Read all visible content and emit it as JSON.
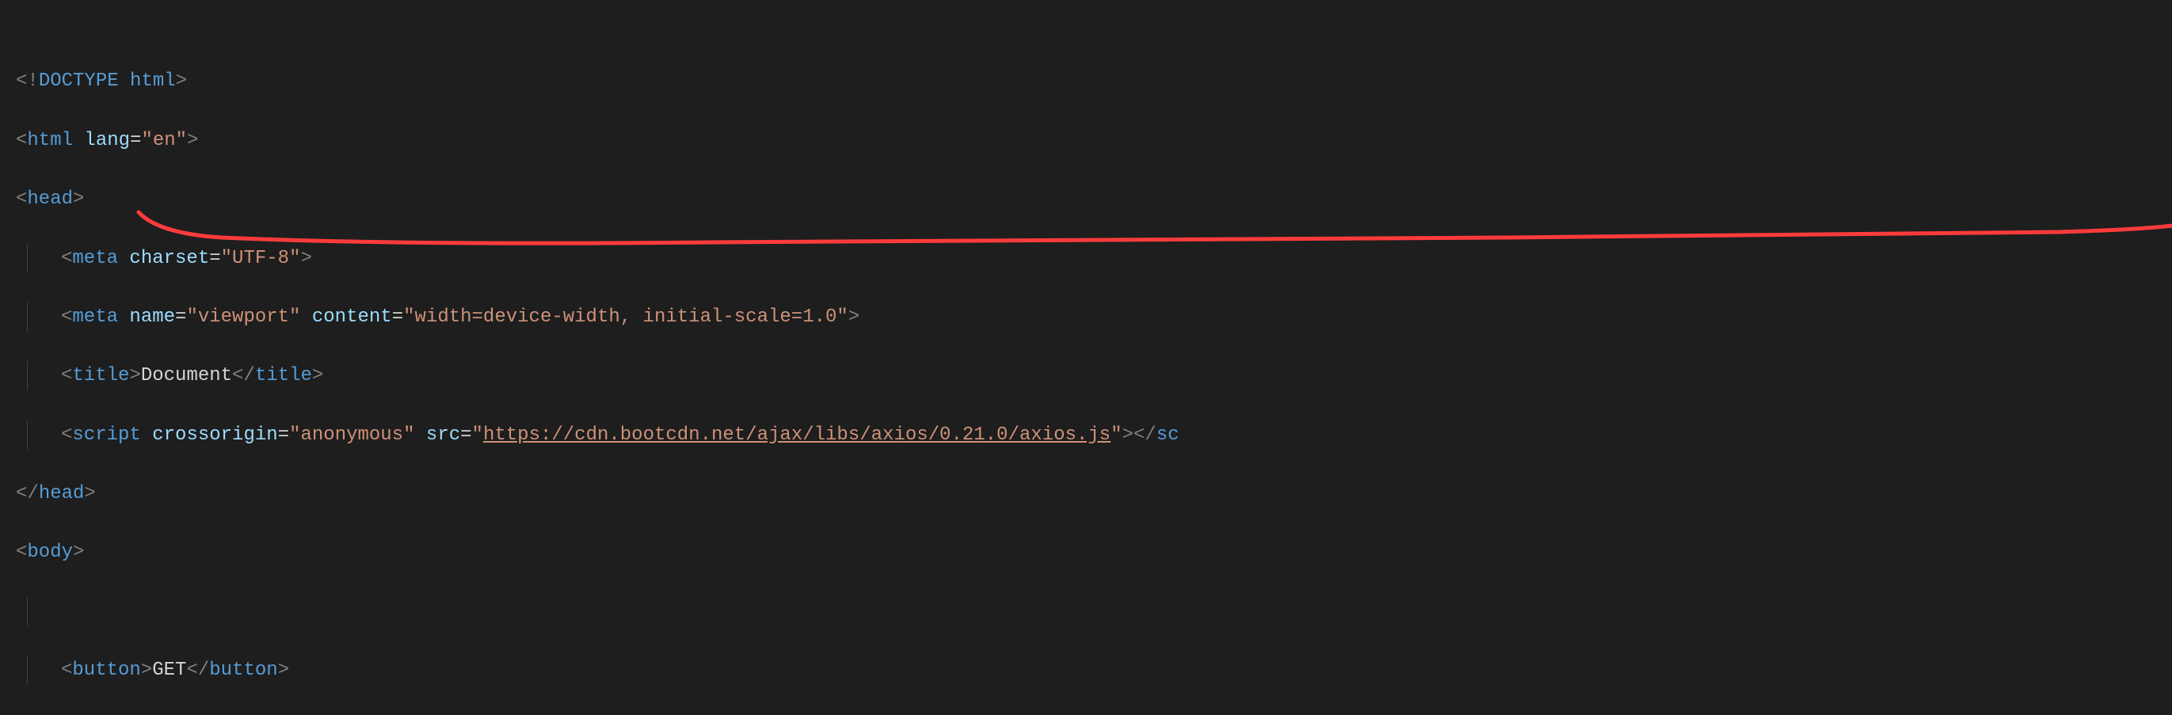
{
  "code": {
    "l1": {
      "open": "<!",
      "doctype": "DOCTYPE",
      "space": " ",
      "html": "html",
      "close": ">"
    },
    "l2": {
      "open": "<",
      "tag": "html",
      "attr": "lang",
      "eq": "=",
      "val": "\"en\"",
      "close": ">"
    },
    "l3": {
      "open": "<",
      "tag": "head",
      "close": ">"
    },
    "l4": {
      "open": "<",
      "tag": "meta",
      "attr": "charset",
      "eq": "=",
      "val": "\"UTF-8\"",
      "close": ">"
    },
    "l5": {
      "open": "<",
      "tag": "meta",
      "attr1": "name",
      "eq1": "=",
      "val1": "\"viewport\"",
      "attr2": "content",
      "eq2": "=",
      "val2": "\"width=device-width, initial-scale=1.0\"",
      "close": ">"
    },
    "l6": {
      "open": "<",
      "tag": "title",
      "close1": ">",
      "text": "Document",
      "open2": "</",
      "tag2": "title",
      "close2": ">"
    },
    "l7": {
      "open": "<",
      "tag": "script",
      "attr1": "crossorigin",
      "eq1": "=",
      "val1": "\"anonymous\"",
      "attr2": "src",
      "eq2": "=",
      "val2q": "\"",
      "val2url": "https://cdn.bootcdn.net/ajax/libs/axios/0.21.0/axios.js",
      "val2q2": "\"",
      "close1": ">",
      "open2": "</",
      "tag2": "sc"
    },
    "l8": {
      "open": "</",
      "tag": "head",
      "close": ">"
    },
    "l9": {
      "open": "<",
      "tag": "body",
      "close": ">"
    },
    "l10": {
      "open": "<",
      "tag": "button",
      "close1": ">",
      "text": "GET",
      "open2": "</",
      "tag2": "button",
      "close2": ">"
    }
  }
}
